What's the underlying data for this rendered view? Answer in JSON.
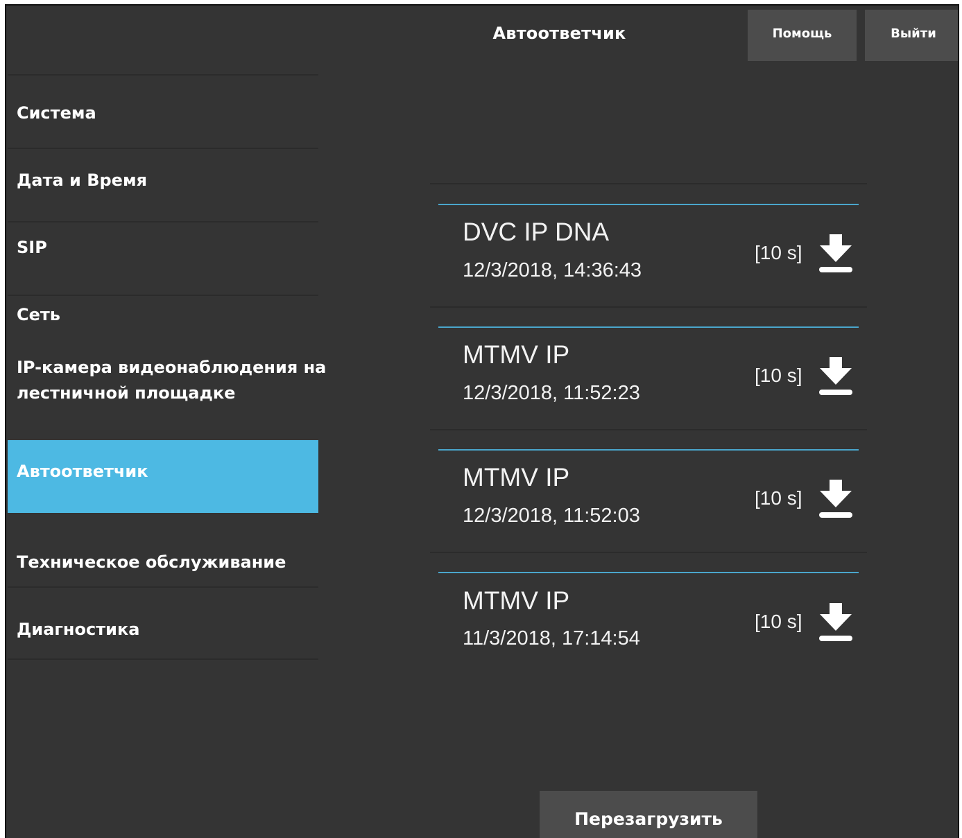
{
  "header": {
    "title": "Автоответчик",
    "help_label": "Помощь",
    "exit_label": "Выйти"
  },
  "sidebar": {
    "active_index": 5,
    "active_color": "#4db9e3",
    "items": [
      {
        "label": "Система"
      },
      {
        "label": "Дата и Время"
      },
      {
        "label": "SIP"
      },
      {
        "label": "Сеть"
      },
      {
        "label": "IP-камера видеонаблюдения на лестничной площадке"
      },
      {
        "label": "Автоответчик"
      },
      {
        "label": "Техническое обслуживание"
      },
      {
        "label": "Диагностика"
      }
    ]
  },
  "recordings": [
    {
      "name": "DVC IP DNA",
      "date": "12/3/2018, 14:36:43",
      "duration": "[10 s]",
      "icon": "download-icon"
    },
    {
      "name": "MTMV IP",
      "date": "12/3/2018, 11:52:23",
      "duration": "[10 s]",
      "icon": "download-icon"
    },
    {
      "name": "MTMV IP",
      "date": "12/3/2018, 11:52:03",
      "duration": "[10 s]",
      "icon": "download-icon"
    },
    {
      "name": "MTMV IP",
      "date": "11/3/2018, 17:14:54",
      "duration": "[10 s]",
      "icon": "download-icon"
    }
  ],
  "footer": {
    "reload_label": "Перезагрузить"
  },
  "colors": {
    "background": "#343434",
    "button": "#4c4c4c",
    "accent_line": "#4aa6cc"
  }
}
